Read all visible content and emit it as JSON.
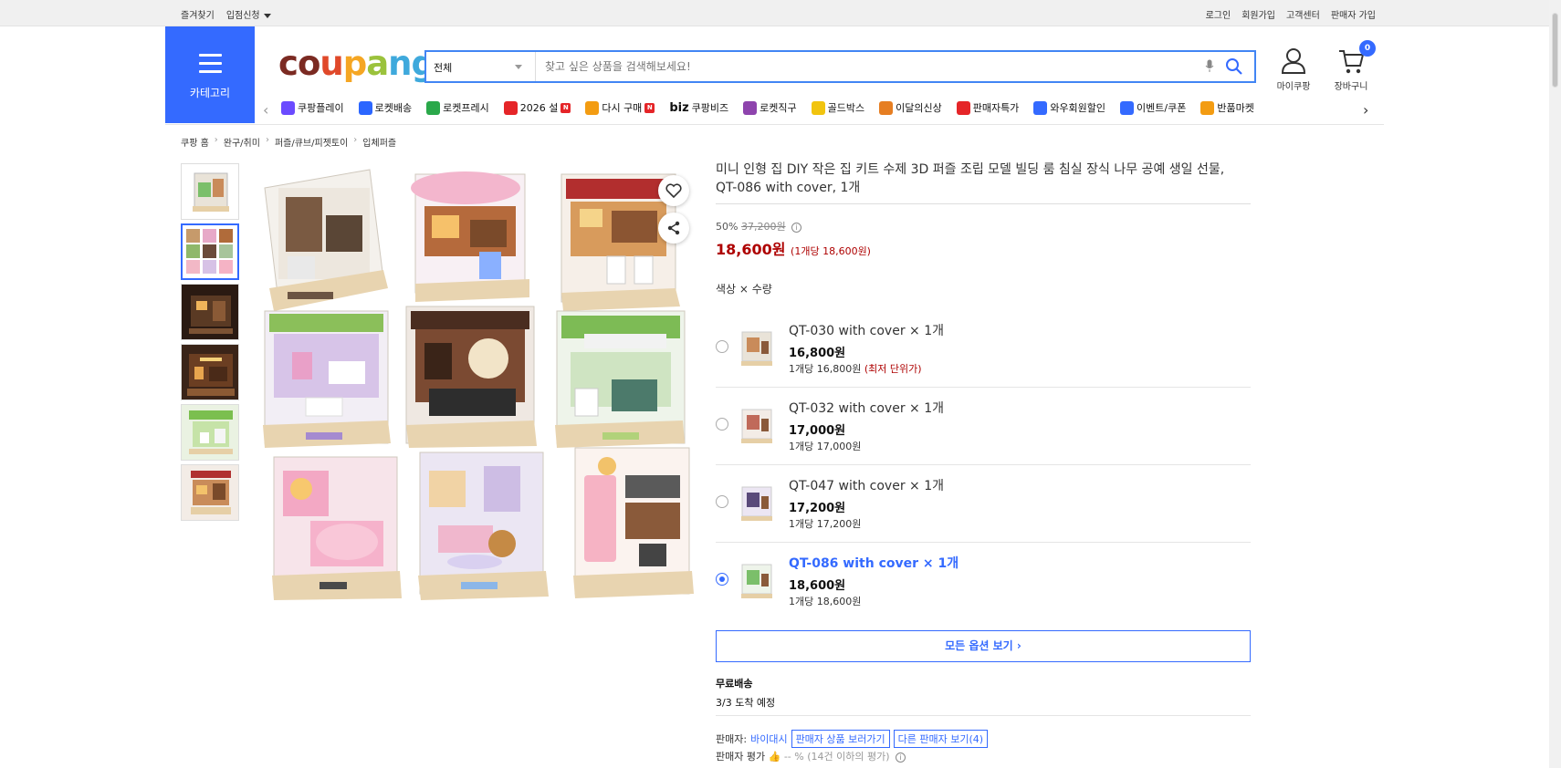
{
  "topbar": {
    "left": [
      "즐겨찾기",
      "입점신청"
    ],
    "right": [
      "로그인",
      "회원가입",
      "고객센터",
      "판매자 가입"
    ]
  },
  "header": {
    "category_label": "카테고리",
    "search": {
      "category": "전체",
      "placeholder": "찾고 싶은 상품을 검색해보세요!"
    },
    "mycoupang": "마이쿠팡",
    "cart": "장바구니",
    "cart_count": "0"
  },
  "nav": [
    {
      "label": "쿠팡플레이",
      "color": "#6b4bff",
      "icon": "play-icon"
    },
    {
      "label": "로켓배송",
      "color": "#2b66ff",
      "icon": "rocket-icon"
    },
    {
      "label": "로켓프레시",
      "color": "#2aa84a",
      "icon": "rocket-icon"
    },
    {
      "label": "2026 설",
      "color": "#e52528",
      "icon": "gift-icon",
      "badge": "N"
    },
    {
      "label": "다시 구매",
      "color": "#f39c12",
      "icon": "home-icon",
      "badge": "N"
    },
    {
      "label": "쿠팡비즈",
      "color": "#333333",
      "icon": "biz-icon",
      "prefix": "biz"
    },
    {
      "label": "로켓직구",
      "color": "#8e44ad",
      "icon": "globe-icon"
    },
    {
      "label": "골드박스",
      "color": "#f1c40f",
      "icon": "box-icon"
    },
    {
      "label": "이달의신상",
      "color": "#e67e22",
      "icon": "bag-icon"
    },
    {
      "label": "판매자특가",
      "color": "#e52528",
      "icon": "percent-icon"
    },
    {
      "label": "와우회원할인",
      "color": "#346aff",
      "icon": "wow-icon"
    },
    {
      "label": "이벤트/쿠폰",
      "color": "#346aff",
      "icon": "ticket-icon"
    },
    {
      "label": "반품마켓",
      "color": "#f39c12",
      "icon": "store-icon"
    }
  ],
  "breadcrumb": [
    "쿠팡 홈",
    "완구/취미",
    "퍼즐/큐브/피젯토이",
    "입체퍼즐"
  ],
  "product": {
    "title": "미니 인형 집 DIY 작은 집 키트 수제 3D 퍼즐 조립 모델 빌딩 룸 침실 장식 나무 공예 생일 선물, QT-086 with cover, 1개",
    "discount": "50%",
    "original_price": "37,200원",
    "price": "18,600원",
    "unit_price": "(1개당 18,600원)",
    "option_label": "색상 × 수량"
  },
  "options": [
    {
      "name": "QT-030 with cover × 1개",
      "price": "16,800원",
      "unit": "1개당 16,800원",
      "tag": "(최저 단위가)",
      "selected": false
    },
    {
      "name": "QT-032 with cover × 1개",
      "price": "17,000원",
      "unit": "1개당 17,000원",
      "tag": "",
      "selected": false
    },
    {
      "name": "QT-047 with cover × 1개",
      "price": "17,200원",
      "unit": "1개당 17,200원",
      "tag": "",
      "selected": false
    },
    {
      "name": "QT-086 with cover × 1개",
      "price": "18,600원",
      "unit": "1개당 18,600원",
      "tag": "",
      "selected": true
    }
  ],
  "all_options": "모든 옵션 보기",
  "shipping": {
    "title": "무료배송",
    "eta": "3/3 도착 예정"
  },
  "seller": {
    "label": "판매자:",
    "name": "바이대시",
    "view_products": "판매자 상품 보러가기",
    "other_sellers": "다른 판매자 보기",
    "other_count": "(4)"
  },
  "rating": {
    "label": "판매자 평가",
    "value": "-- %",
    "note": "(14건 이하의 평가)"
  },
  "colors": {
    "accent": "#346aff",
    "price_red": "#ae0000"
  }
}
